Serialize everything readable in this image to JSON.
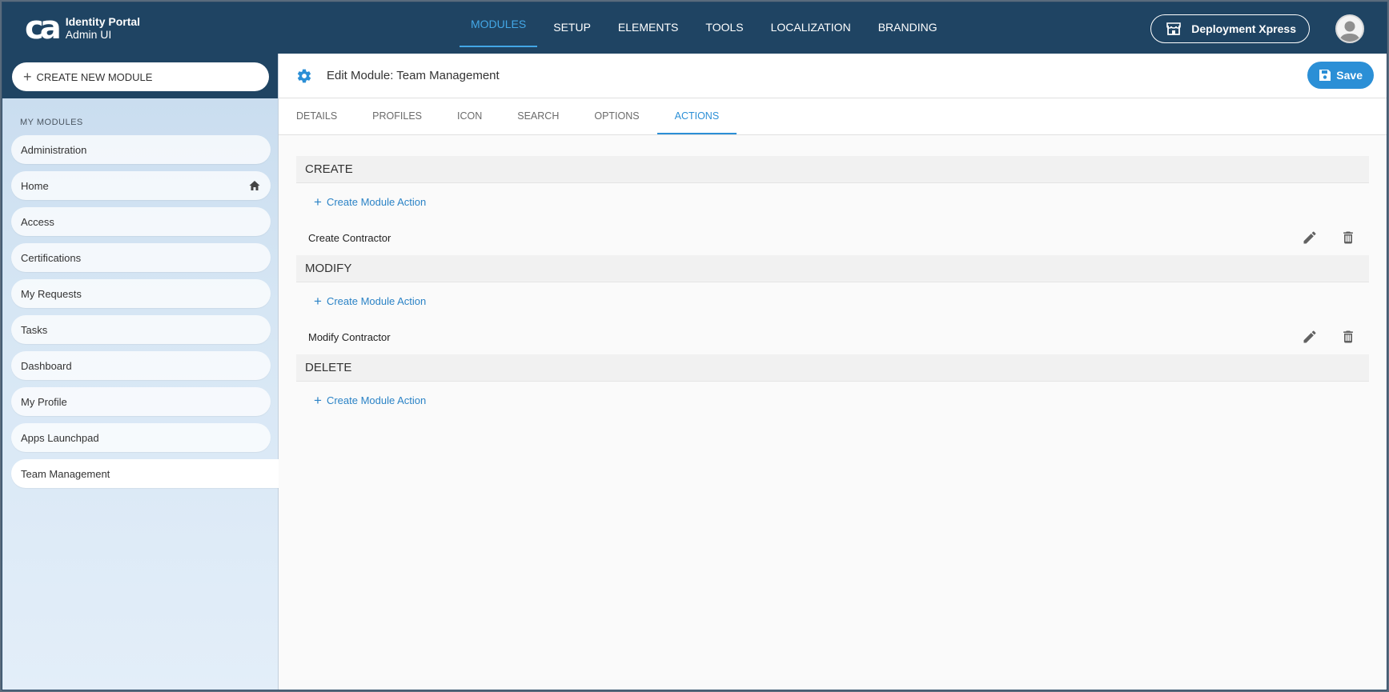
{
  "app": {
    "logo_text": "ca",
    "title_line1": "Identity Portal",
    "title_line2": "Admin UI"
  },
  "nav": {
    "items": [
      {
        "label": "MODULES",
        "active": true
      },
      {
        "label": "SETUP"
      },
      {
        "label": "ELEMENTS"
      },
      {
        "label": "TOOLS"
      },
      {
        "label": "LOCALIZATION"
      },
      {
        "label": "BRANDING"
      }
    ],
    "deploy_label": "Deployment Xpress"
  },
  "sidebar": {
    "create_label": "CREATE NEW MODULE",
    "section_label": "MY MODULES",
    "items": [
      {
        "label": "Administration"
      },
      {
        "label": "Home",
        "icon": "home-icon"
      },
      {
        "label": "Access"
      },
      {
        "label": "Certifications"
      },
      {
        "label": "My Requests"
      },
      {
        "label": "Tasks"
      },
      {
        "label": "Dashboard"
      },
      {
        "label": "My Profile"
      },
      {
        "label": "Apps Launchpad"
      },
      {
        "label": "Team Management",
        "active": true
      }
    ]
  },
  "header": {
    "title": "Edit Module: Team Management",
    "save_label": "Save"
  },
  "tabs": [
    {
      "label": "DETAILS"
    },
    {
      "label": "PROFILES"
    },
    {
      "label": "ICON"
    },
    {
      "label": "SEARCH"
    },
    {
      "label": "OPTIONS"
    },
    {
      "label": "ACTIONS",
      "active": true
    }
  ],
  "sections": [
    {
      "title": "CREATE",
      "create_label": "Create Module Action",
      "actions": [
        "Create Contractor"
      ]
    },
    {
      "title": "MODIFY",
      "create_label": "Create Module Action",
      "actions": [
        "Modify Contractor"
      ]
    },
    {
      "title": "DELETE",
      "create_label": "Create Module Action",
      "actions": []
    }
  ],
  "colors": {
    "topbar": "#1f4463",
    "accent": "#2b8fd6",
    "active_nav": "#43a7e6"
  }
}
